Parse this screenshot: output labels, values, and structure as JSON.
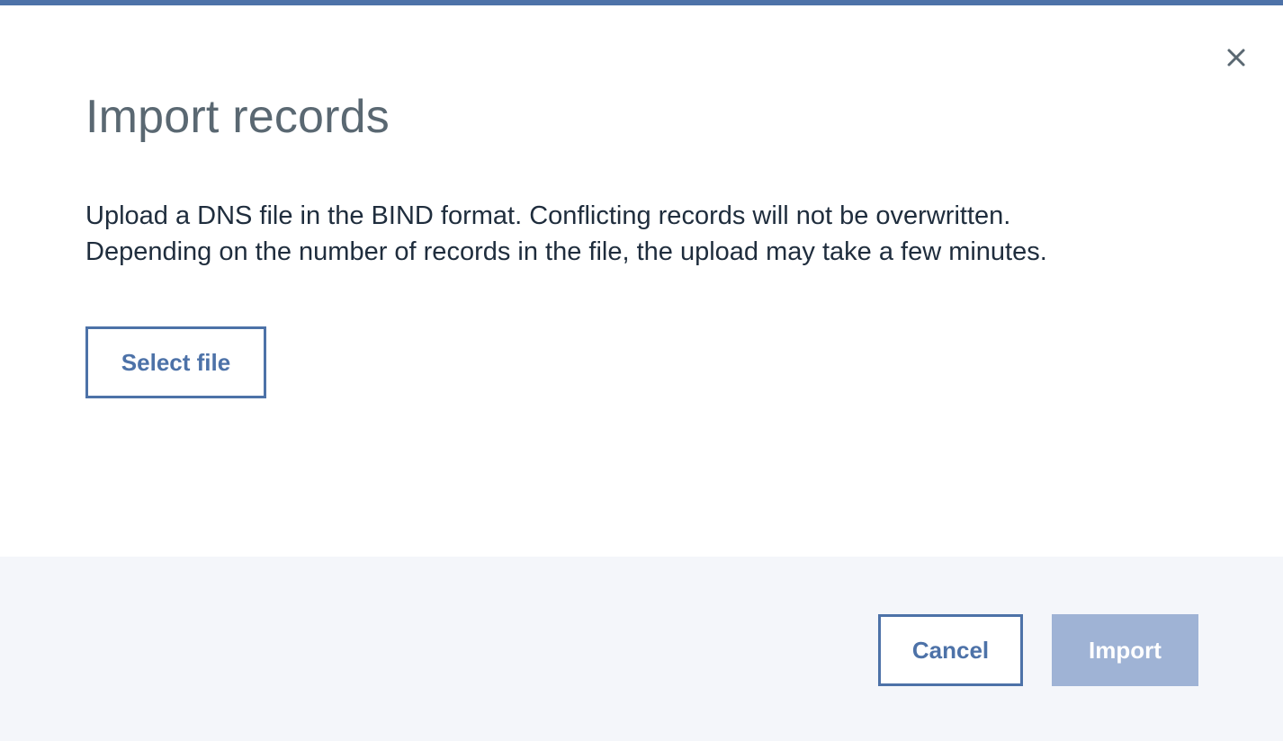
{
  "modal": {
    "title": "Import records",
    "description_lines": [
      "Upload a DNS file in the BIND format. Conflicting records will not be overwritten.",
      "Depending on the number of records in the file, the upload may take a few minutes."
    ],
    "select_file_label": "Select file",
    "close_icon": "close-icon"
  },
  "footer": {
    "cancel_label": "Cancel",
    "import_label": "Import",
    "import_disabled": true
  },
  "colors": {
    "accent": "#4d72a8",
    "accent_disabled": "#9fb3d5",
    "title_text": "#5a6872",
    "body_text": "#1f2d3d",
    "footer_background": "#f4f6fa"
  }
}
